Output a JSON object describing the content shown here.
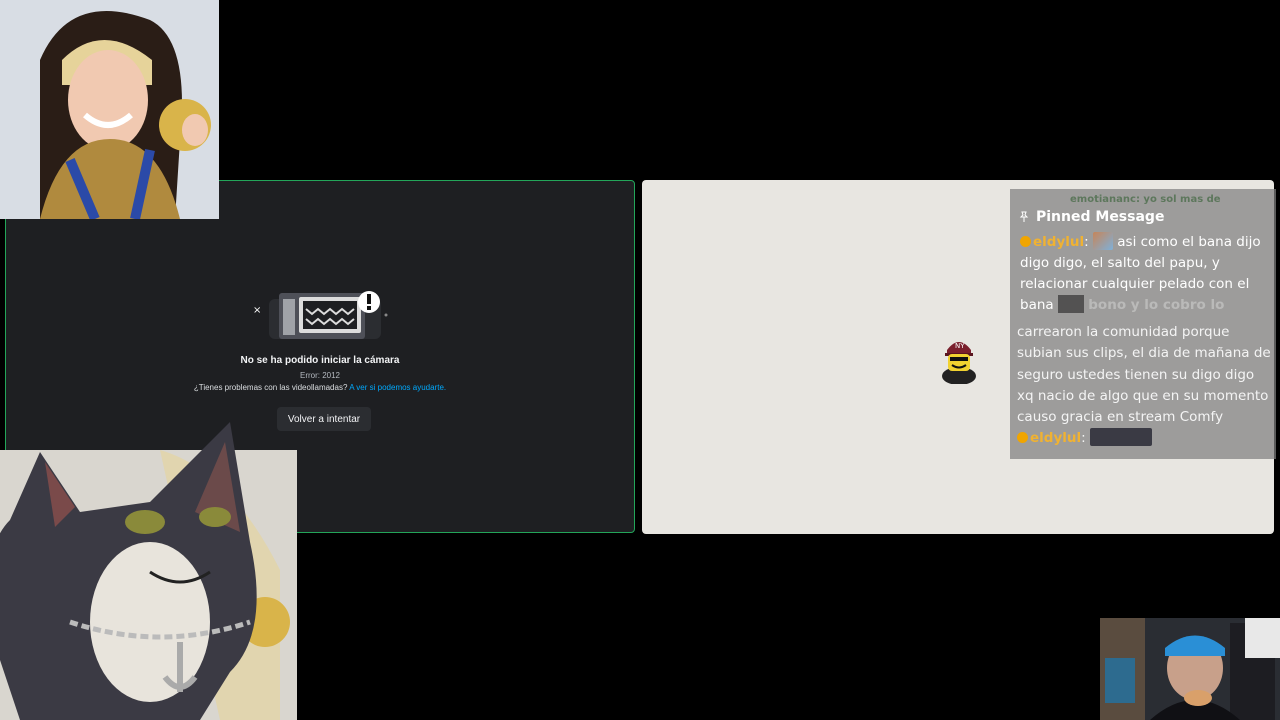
{
  "camera_error": {
    "title": "No se ha podido iniciar la cámara",
    "code": "Error: 2012",
    "help_text": "¿Tienes problemas con las videollamadas?",
    "help_link": "A ver si podemos ayudarte.",
    "retry_label": "Volver a intentar"
  },
  "pinned": {
    "header": "Pinned Message",
    "ghost_text": "emotiananc: yo sol mas de",
    "username": "eldylul",
    "message": "asi como el bana dijo digo digo, el salto del papu, y relacionar cualquier pelado con el bana",
    "blurred_text": "bono y lo cobro lo",
    "continuation": "carrearon la comunidad porque subian sus clips, el dia de mañana de seguro ustedes tienen su digo digo xq nacio de algo que en su momento causo gracia en stream Comfy",
    "username2": "eldylul"
  },
  "colors": {
    "accent_green": "#23a559",
    "link_blue": "#00a8fc",
    "username_gold": "#f0b232"
  }
}
